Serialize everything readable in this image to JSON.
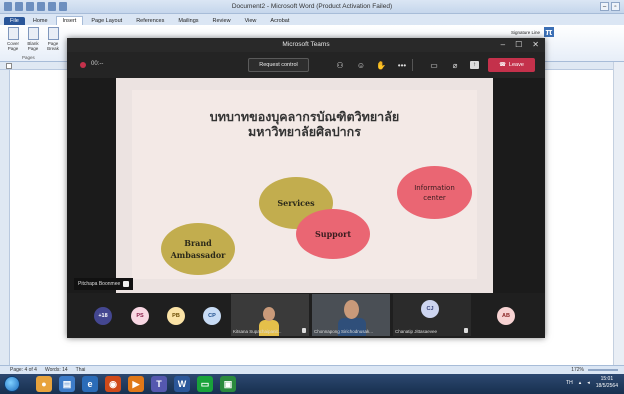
{
  "word": {
    "title": "Document2 - Microsoft Word (Product Activation Failed)",
    "tabs": [
      "File",
      "Home",
      "Insert",
      "Page Layout",
      "References",
      "Mailings",
      "Review",
      "View",
      "Acrobat"
    ],
    "ribbon": {
      "cover_page": "Cover Page",
      "blank_page": "Blank Page",
      "page_break": "Page Break",
      "group_pages": "Pages",
      "signature_line": "Signature Line"
    },
    "status": {
      "page": "Page: 4 of 4",
      "words": "Words: 14",
      "language": "Thai",
      "zoom": "172%"
    }
  },
  "teams": {
    "window_title": "Microsoft Teams",
    "timer": "00:--",
    "request_control_label": "Request control",
    "leave_label": "Leave",
    "presenter_name": "Pitchapa Boonmee",
    "slide": {
      "title_line1": "บทบาทของบุคลากรบัณฑิตวิทยาลัย",
      "title_line2": "มหาวิทยาลัยศิลปากร",
      "bubbles": {
        "services": "Services",
        "support": "Support",
        "brand_line1": "Brand",
        "brand_line2": "Ambassador",
        "info_line1": "Information",
        "info_line2": "center"
      }
    },
    "gallery": {
      "more_count": "+18",
      "initials": {
        "ps": "PS",
        "pb": "PB",
        "cp": "CP",
        "cj": "CJ",
        "ab": "AB"
      },
      "tile1_name": "Kitsana Supachaipanit...",
      "tile2_name": "Chonnapong Sirichodnusak...",
      "tile3_name": "Chanatip Jittasaevee"
    }
  },
  "taskbar": {
    "lang": "TH",
    "time": "15:01",
    "date": "18/5/2564"
  },
  "colors": {
    "teams_leave": "#c4314b",
    "bubble_gold": "#c2ad4e",
    "bubble_pink": "#ea6673",
    "slide_bg": "#f3e9e6",
    "word_file_tab": "#2a5699"
  }
}
